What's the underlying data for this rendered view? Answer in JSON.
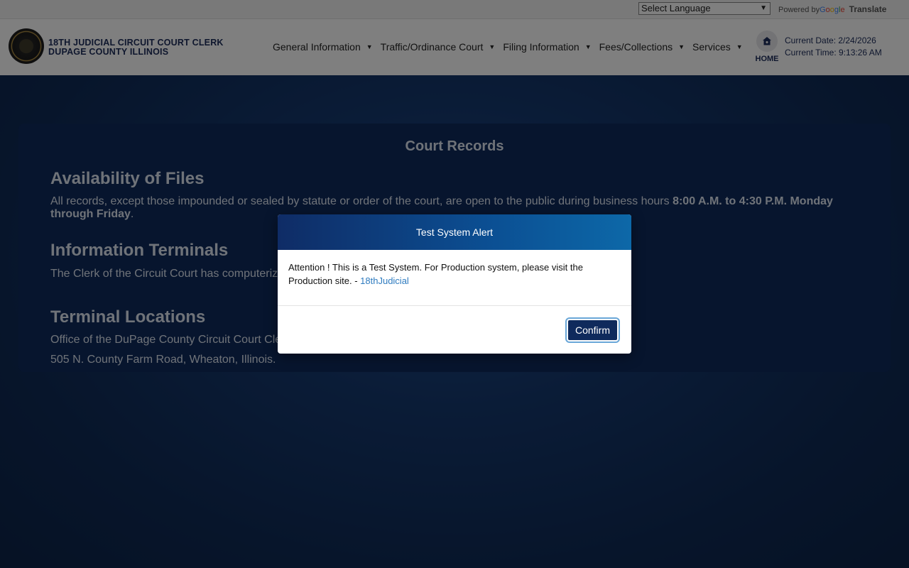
{
  "translate": {
    "select_language": "Select Language",
    "powered_by": "Powered by",
    "google": [
      "G",
      "o",
      "o",
      "g",
      "l",
      "e"
    ],
    "translate_label": "Translate"
  },
  "header": {
    "brand_line1": "18TH JUDICIAL CIRCUIT COURT CLERK",
    "brand_line2": "DUPAGE COUNTY ILLINOIS",
    "nav": [
      {
        "label": "General Information"
      },
      {
        "label": "Traffic/Ordinance Court"
      },
      {
        "label": "Filing Information"
      },
      {
        "label": "Fees/Collections"
      },
      {
        "label": "Services"
      }
    ],
    "home_label": "HOME",
    "current_date": "Current Date: 2/24/2026",
    "current_time": "Current Time: 9:13:26 AM"
  },
  "content": {
    "title": "Court Records",
    "availability_heading": "Availability of Files",
    "availability_text": "All records, except those impounded or sealed by statute or order of the court, are open to the public during business hours ",
    "availability_hours": "8:00 A.M. to 4:30 P.M. Monday through Friday",
    "availability_end": ".",
    "terminals_heading": "Information Terminals",
    "terminals_text": "The Clerk of the Circuit Court has computeriz",
    "locations_heading": "Terminal Locations",
    "locations_line1": "Office of the DuPage County Circuit Court Cle",
    "locations_line2": "505 N. County Farm Road, Wheaton, Illinois."
  },
  "modal": {
    "title": "Test System Alert",
    "message": "Attention ! This is a Test System. For Production system, please visit the Production site. - ",
    "link_text": "18thJudicial",
    "confirm_label": "Confirm"
  }
}
